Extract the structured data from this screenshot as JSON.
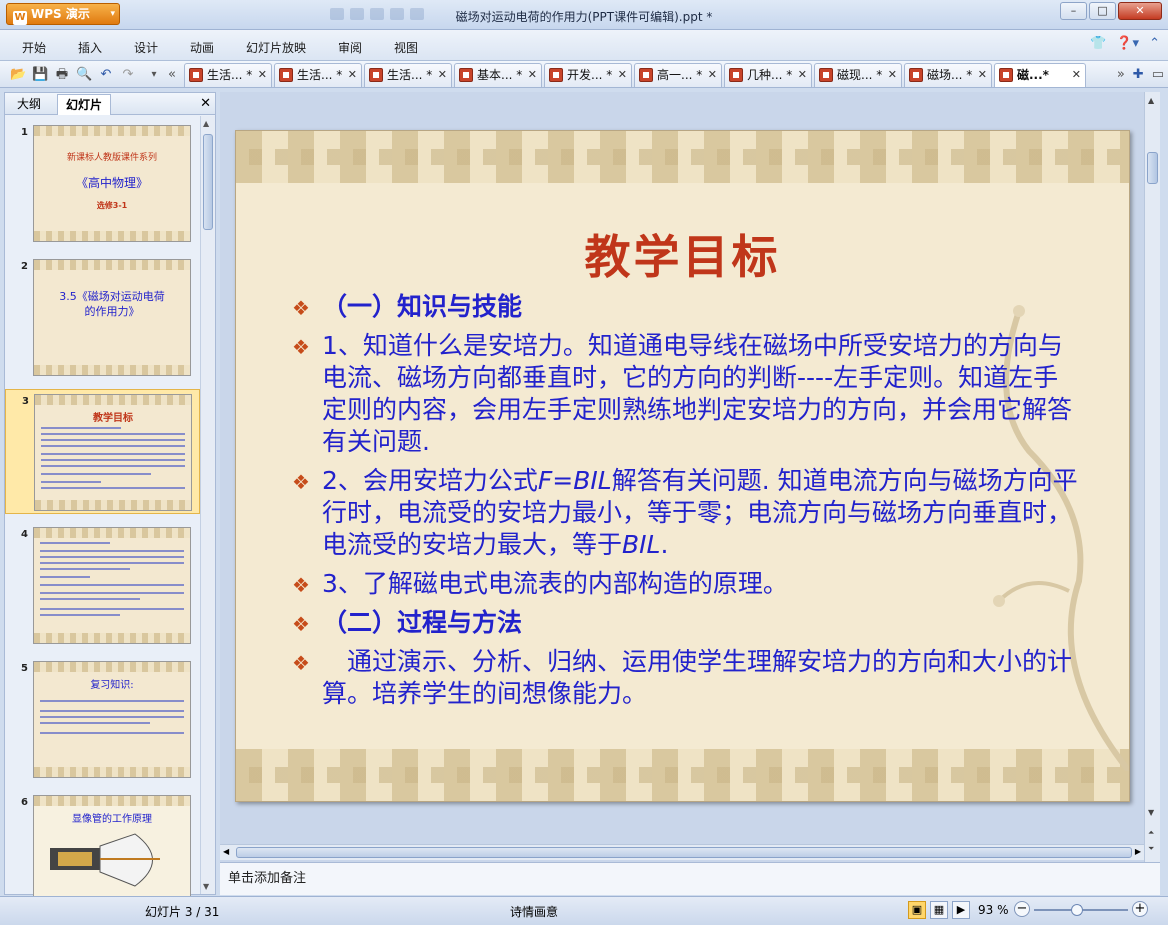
{
  "app": {
    "logo": "W",
    "name": "WPS 演示",
    "dropdown": "▾"
  },
  "window": {
    "title": "磁场对运动电荷的作用力(PPT课件可编辑).ppt *",
    "minimize": "–",
    "maximize": "□",
    "close": "✕"
  },
  "menu": {
    "items": [
      "开始",
      "插入",
      "设计",
      "动画",
      "幻灯片放映",
      "审阅",
      "视图"
    ],
    "right_icons": [
      "skin-icon",
      "help-icon",
      "minimize-ribbon-icon"
    ]
  },
  "toolbar": {
    "icons": [
      "open-folder-icon",
      "save-icon",
      "print-icon",
      "print-preview-icon",
      "undo-icon",
      "redo-icon",
      "customize-dropdown-icon",
      "tab-scroll-left-icon"
    ],
    "tabs": [
      {
        "label": "生活... *"
      },
      {
        "label": "生活... *"
      },
      {
        "label": "生活... *"
      },
      {
        "label": "基本... *"
      },
      {
        "label": "开发... *"
      },
      {
        "label": "高一... *"
      },
      {
        "label": "几种... *"
      },
      {
        "label": "磁现... *"
      },
      {
        "label": "磁场... *"
      },
      {
        "label": "磁...*"
      }
    ],
    "tab_close": "✕",
    "right_icons": [
      "tab-scroll-right-icon",
      "new-tab-icon",
      "tab-list-icon"
    ]
  },
  "left_panel": {
    "tabs": [
      "大纲",
      "幻灯片"
    ],
    "active_tab": 1,
    "close": "✕",
    "thumbnails": [
      {
        "num": "1",
        "lines": [
          "新课标人教版课件系列",
          "《高中物理》",
          "选修3-1"
        ]
      },
      {
        "num": "2",
        "lines": [
          "3.5《磁场对运动电荷",
          "的作用力》"
        ]
      },
      {
        "num": "3",
        "lines": [
          "教学目标"
        ]
      },
      {
        "num": "4",
        "lines": []
      },
      {
        "num": "5",
        "lines": [
          "复习知识:"
        ]
      },
      {
        "num": "6",
        "lines": [
          "显像管的工作原理"
        ]
      }
    ],
    "selected_index": 2
  },
  "slide": {
    "title": "教学目标",
    "bullet_glyph": "❖",
    "h1": "（一）知识与技能",
    "p1": "1、知道什么是安培力。知道通电导线在磁场中所受安培力的方向与电流、磁场方向都垂直时，它的方向的判断----左手定则。知道左手定则的内容，会用左手定则熟练地判定安培力的方向，并会用它解答有关问题.",
    "p2_a": "2、会用安培力公式",
    "p2_formula": "F=BIL",
    "p2_b": "解答有关问题. 知道电流方向与磁场方向平行时，电流受的安培力最小，等于零；电流方向与磁场方向垂直时，电流受的安培力最大，等于",
    "p2_bil": "BIL",
    "p2_end": ".",
    "p3": "3、了解磁电式电流表的内部构造的原理。",
    "h2": "（二）过程与方法",
    "p4": "　通过演示、分析、归纳、运用使学生理解安培力的方向和大小的计算。培养学生的间想像能力。"
  },
  "notes": {
    "placeholder": "单击添加备注"
  },
  "status": {
    "slide_info": "幻灯片 3 / 31",
    "theme": "诗情画意",
    "view_icons": [
      "normal-view-icon",
      "slide-sorter-icon",
      "slideshow-icon"
    ],
    "zoom": "93 %",
    "zoom_value": 0.46,
    "zoom_minus": "−",
    "zoom_plus": "+"
  },
  "colors": {
    "title_red": "#c0361a",
    "body_blue": "#2222cc",
    "bullet_orange": "#c64c1a",
    "accent_orange": "#e07a10"
  }
}
